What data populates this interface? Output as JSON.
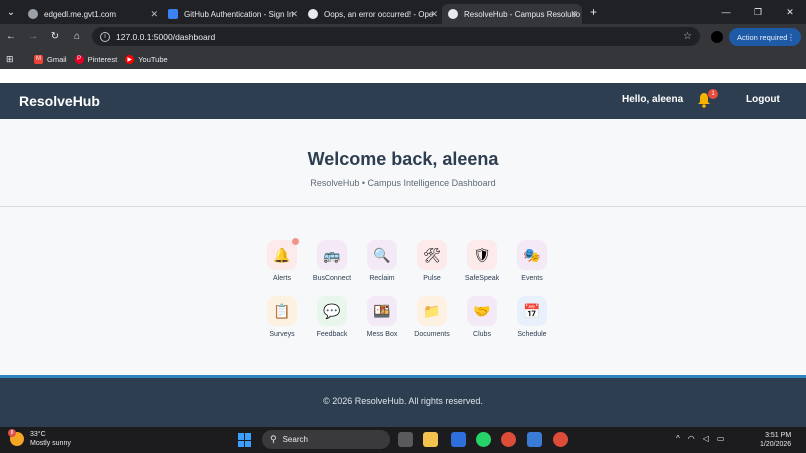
{
  "browser": {
    "tabs": [
      {
        "title": "edgedl.me.gvt1.com",
        "active": false,
        "favicon_color": "#9aa0a6"
      },
      {
        "title": "GitHub Authentication - Sign In",
        "active": false,
        "favicon_color": "#3b82f6"
      },
      {
        "title": "Oops, an error occurred! - Ope",
        "active": false,
        "favicon_color": "#e8eaed"
      },
      {
        "title": "ResolveHub - Campus Resolutio",
        "active": true,
        "favicon_color": "#e8eaed"
      }
    ],
    "url": "127.0.0.1:5000/dashboard",
    "action_required": "Action required",
    "bookmarks": [
      "Gmail",
      "Pinterest",
      "YouTube"
    ]
  },
  "nav": {
    "brand": "ResolveHub",
    "greeting": "Hello, aleena",
    "notification_count": "1",
    "logout": "Logout"
  },
  "hero": {
    "welcome": "Welcome back, aleena",
    "subtitle": "ResolveHub • Campus Intelligence Dashboard"
  },
  "modules": [
    {
      "label": "Alerts",
      "icon": "bell-icon",
      "glyph": "🔔",
      "bg": "#fdeaea"
    },
    {
      "label": "BusConnect",
      "icon": "bus-icon",
      "glyph": "🚌",
      "bg": "#f4e9f7"
    },
    {
      "label": "Reclaim",
      "icon": "magnifier-icon",
      "glyph": "🔍",
      "bg": "#f4e9f7"
    },
    {
      "label": "Pulse",
      "icon": "tools-icon",
      "glyph": "🛠",
      "bg": "#fdeaea"
    },
    {
      "label": "SafeSpeak",
      "icon": "shield-icon",
      "glyph": "🛡",
      "bg": "#fdeaea"
    },
    {
      "label": "Events",
      "icon": "masks-icon",
      "glyph": "🎭",
      "bg": "#f4e9f7"
    },
    {
      "label": "Surveys",
      "icon": "clipboard-icon",
      "glyph": "📋",
      "bg": "#fdf1e2"
    },
    {
      "label": "Feedback",
      "icon": "speech-bubble-icon",
      "glyph": "💬",
      "bg": "#e9f6ec"
    },
    {
      "label": "Mess Box",
      "icon": "food-box-icon",
      "glyph": "🍱",
      "bg": "#f4e9f7"
    },
    {
      "label": "Documents",
      "icon": "folder-icon",
      "glyph": "📁",
      "bg": "#fdf1e2"
    },
    {
      "label": "Clubs",
      "icon": "handshake-icon",
      "glyph": "🤝",
      "bg": "#f4e9f7"
    },
    {
      "label": "Schedule",
      "icon": "calendar-icon",
      "glyph": "📅",
      "bg": "#e8f1fb"
    }
  ],
  "footer": {
    "text": "© 2026 ResolveHub. All rights reserved."
  },
  "taskbar": {
    "temperature": "33°C",
    "weather": "Mostly sunny",
    "weather_badge": "8",
    "search": "Search",
    "time": "3:51 PM",
    "date": "1/20/2026"
  },
  "colors": {
    "nav_bg": "#2c3e50",
    "footer_accent": "#2e86c1",
    "badge": "#e74c3c"
  }
}
